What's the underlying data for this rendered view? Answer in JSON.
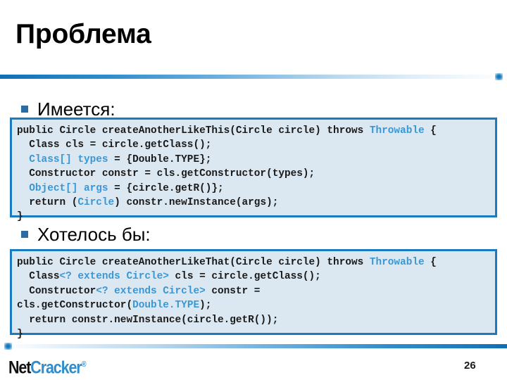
{
  "slide": {
    "title": "Проблема",
    "page_number": "26"
  },
  "colors": {
    "accent_blue": "#1a7cc0",
    "keyword_blue": "#3a97d4",
    "bullet_blue": "#2b6ca3",
    "code_background": "#dce8f1",
    "logo_blue": "#2f8dcc"
  },
  "bullets": [
    {
      "label": "Имеется:"
    },
    {
      "label": "Хотелось бы:"
    }
  ],
  "code_blocks": [
    {
      "id": "have",
      "lines": [
        [
          {
            "t": "public Circle createAnotherLikeThis(Circle circle) throws ",
            "k": false
          },
          {
            "t": "Throwable",
            "k": true
          },
          {
            "t": " {",
            "k": false
          }
        ],
        [
          {
            "t": "  Class cls = circle.getClass();",
            "k": false
          }
        ],
        [
          {
            "t": "  ",
            "k": false
          },
          {
            "t": "Class[] types",
            "k": true
          },
          {
            "t": " = {Double.TYPE};",
            "k": false
          }
        ],
        [
          {
            "t": "  Constructor constr = cls.getConstructor(types);",
            "k": false
          }
        ],
        [
          {
            "t": "  ",
            "k": false
          },
          {
            "t": "Object[] args",
            "k": true
          },
          {
            "t": " = {circle.getR()};",
            "k": false
          }
        ],
        [
          {
            "t": "  return (",
            "k": false
          },
          {
            "t": "Circle",
            "k": true
          },
          {
            "t": ") constr.newInstance(args);",
            "k": false
          }
        ],
        [
          {
            "t": "}",
            "k": false
          }
        ]
      ]
    },
    {
      "id": "want",
      "lines": [
        [
          {
            "t": "public Circle createAnotherLikeThat(Circle circle) throws ",
            "k": false
          },
          {
            "t": "Throwable",
            "k": true
          },
          {
            "t": " {",
            "k": false
          }
        ],
        [
          {
            "t": "  Class",
            "k": false
          },
          {
            "t": "<? extends Circle>",
            "k": true
          },
          {
            "t": " cls = circle.getClass();",
            "k": false
          }
        ],
        [
          {
            "t": "  Constructor",
            "k": false
          },
          {
            "t": "<? extends Circle>",
            "k": true
          },
          {
            "t": " constr =",
            "k": false
          }
        ],
        [
          {
            "t": "cls.getConstructor(",
            "k": false
          },
          {
            "t": "Double.TYPE",
            "k": true
          },
          {
            "t": ");",
            "k": false
          }
        ],
        [
          {
            "t": "  return constr.newInstance(circle.getR());",
            "k": false
          }
        ],
        [
          {
            "t": "}",
            "k": false
          }
        ]
      ]
    }
  ],
  "footer": {
    "logo_part_1": "Net",
    "logo_part_2": "Cracker",
    "logo_registered_mark": "®"
  }
}
